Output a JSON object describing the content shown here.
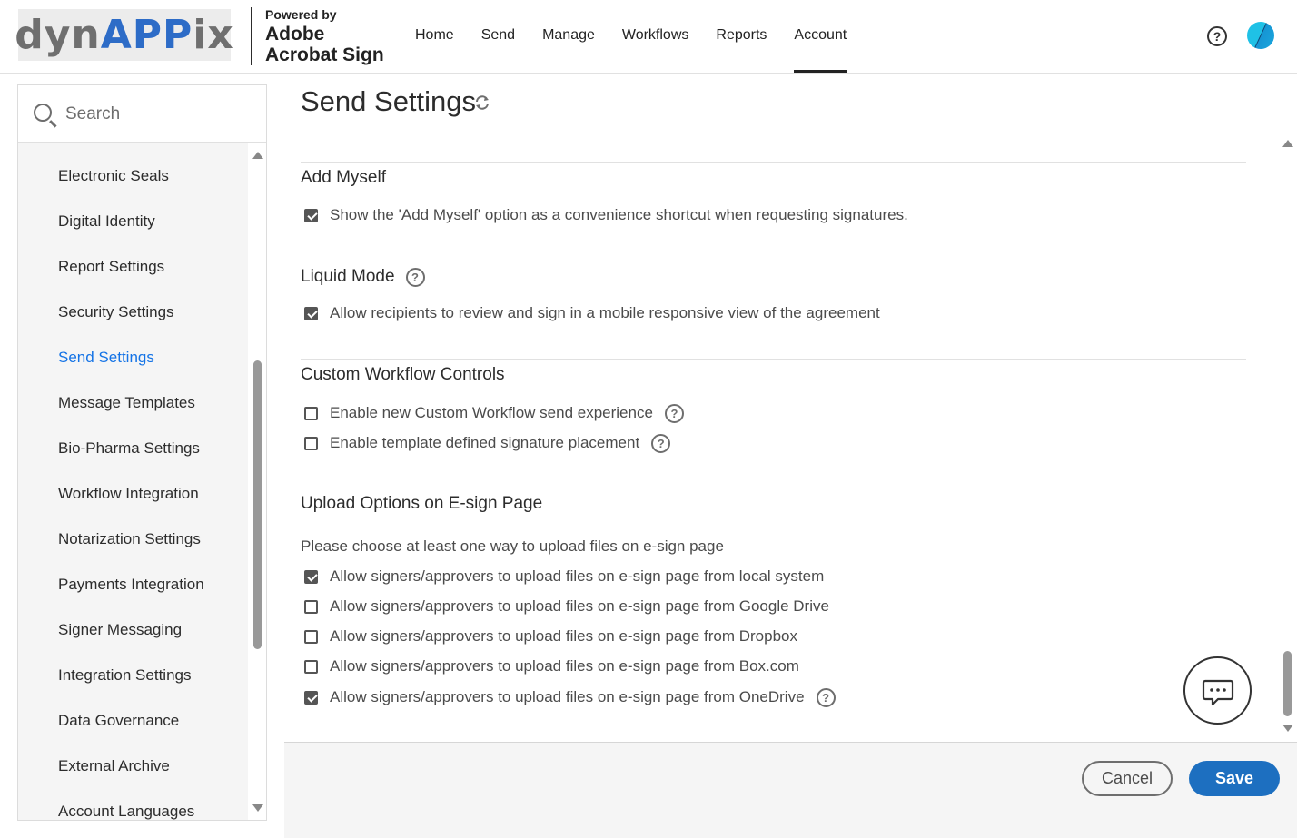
{
  "brand": {
    "logo_text_a": "dyn",
    "logo_text_b": "APP",
    "logo_text_c": "ix",
    "powered_by": "Powered by",
    "product_line1": "Adobe",
    "product_line2": "Acrobat Sign"
  },
  "nav": {
    "items": [
      "Home",
      "Send",
      "Manage",
      "Workflows",
      "Reports",
      "Account"
    ],
    "active": "Account"
  },
  "header": {
    "help_icon": "?"
  },
  "search": {
    "placeholder": "Search"
  },
  "sidebar": {
    "items": [
      "Electronic Seals",
      "Digital Identity",
      "Report Settings",
      "Security Settings",
      "Send Settings",
      "Message Templates",
      "Bio-Pharma Settings",
      "Workflow Integration",
      "Notarization Settings",
      "Payments Integration",
      "Signer Messaging",
      "Integration Settings",
      "Data Governance",
      "External Archive",
      "Account Languages"
    ],
    "active": "Send Settings"
  },
  "page": {
    "title": "Send Settings"
  },
  "sections": {
    "add_myself": {
      "title": "Add Myself",
      "options": [
        {
          "label": "Show the 'Add Myself' option as a convenience shortcut when requesting signatures.",
          "checked": true
        }
      ]
    },
    "liquid_mode": {
      "title": "Liquid Mode",
      "options": [
        {
          "label": "Allow recipients to review and sign in a mobile responsive view of the agreement",
          "checked": true
        }
      ]
    },
    "custom_workflow": {
      "title": "Custom Workflow Controls",
      "options": [
        {
          "label": "Enable new Custom Workflow send experience",
          "checked": false
        },
        {
          "label": "Enable template defined signature placement",
          "checked": false
        }
      ]
    },
    "upload_options": {
      "title": "Upload Options on E-sign Page",
      "description": "Please choose at least one way to upload files on e-sign page",
      "options": [
        {
          "label": "Allow signers/approvers to upload files on e-sign page from local system",
          "checked": true
        },
        {
          "label": "Allow signers/approvers to upload files on e-sign page from Google Drive",
          "checked": false
        },
        {
          "label": "Allow signers/approvers to upload files on e-sign page from Dropbox",
          "checked": false
        },
        {
          "label": "Allow signers/approvers to upload files on e-sign page from Box.com",
          "checked": false
        },
        {
          "label": "Allow signers/approvers to upload files on e-sign page from OneDrive",
          "checked": true
        }
      ]
    }
  },
  "footer": {
    "cancel_label": "Cancel",
    "save_label": "Save"
  },
  "colors": {
    "accent": "#1473e6",
    "save_button": "#1d6fc0",
    "checkbox": "#555555"
  }
}
